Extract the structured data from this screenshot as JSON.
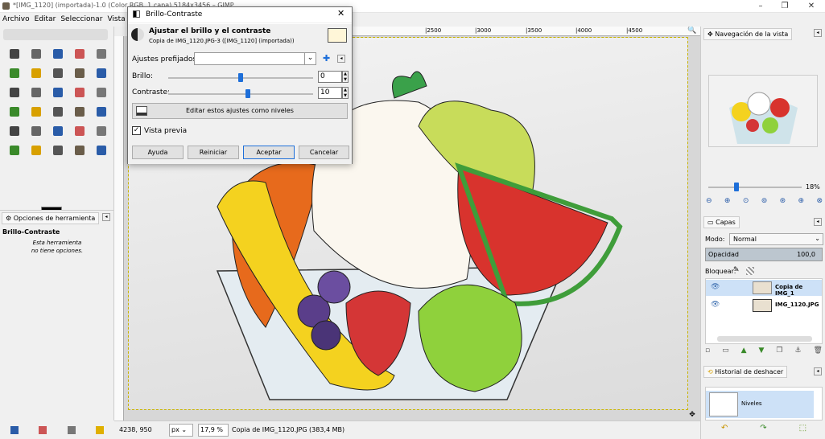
{
  "window": {
    "title": "*[IMG_1120] (importada)-1.0 (Color RGB, 1 capa) 5184x3456 – GIMP",
    "minimize": "–",
    "maximize": "❐",
    "close": "✕"
  },
  "menu": [
    "Archivo",
    "Editar",
    "Seleccionar",
    "Vista"
  ],
  "toolbox": {
    "icon_count": 30
  },
  "tool_options": {
    "tab": "Opciones de herramienta",
    "tool": "Brillo-Contraste",
    "msg1": "Esta herramienta",
    "msg2": "no tiene opciones."
  },
  "dialog": {
    "title": "Brillo-Contraste",
    "heading": "Ajustar el brillo y el contraste",
    "subtitle": "Copia de IMG_1120.JPG-3 ([IMG_1120] (importada))",
    "presets_label": "Ajustes prefijados:",
    "presets_value": "",
    "brightness_label": "Brillo:",
    "brightness_value": "0",
    "brightness_level": 0.5,
    "contrast_label": "Contraste:",
    "contrast_value": "10",
    "contrast_level": 0.55,
    "levels_button": "Editar estos ajustes como niveles",
    "preview_label": "Vista previa",
    "preview_checked": true,
    "buttons": {
      "help": "Ayuda",
      "reset": "Reiniciar",
      "ok": "Aceptar",
      "cancel": "Cancelar"
    }
  },
  "rulers": {
    "top": [
      "|2500",
      "|3000",
      "|3500",
      "|4000",
      "|4500"
    ]
  },
  "status": {
    "coords": "4238, 950",
    "unit": "px",
    "zoom": "17,9 %",
    "info": "Copia de IMG_1120.JPG (383,4 MB)"
  },
  "navigation": {
    "tab": "Navegación de la vista",
    "zoom_value": "18%",
    "zoom_level": 0.3
  },
  "layers": {
    "tab": "Capas",
    "mode_label": "Modo:",
    "mode_value": "Normal",
    "opacity_label": "Opacidad",
    "opacity_value": "100,0",
    "lock_label": "Bloquear:",
    "items": [
      {
        "name": "Copia de IMG_1",
        "active": true
      },
      {
        "name": "IMG_1120.JPG",
        "active": false
      }
    ]
  },
  "undo": {
    "tab": "Historial de deshacer",
    "item": "Niveles"
  },
  "colors": {
    "accent": "#1e6fd9",
    "selection": "#cde1f7"
  }
}
